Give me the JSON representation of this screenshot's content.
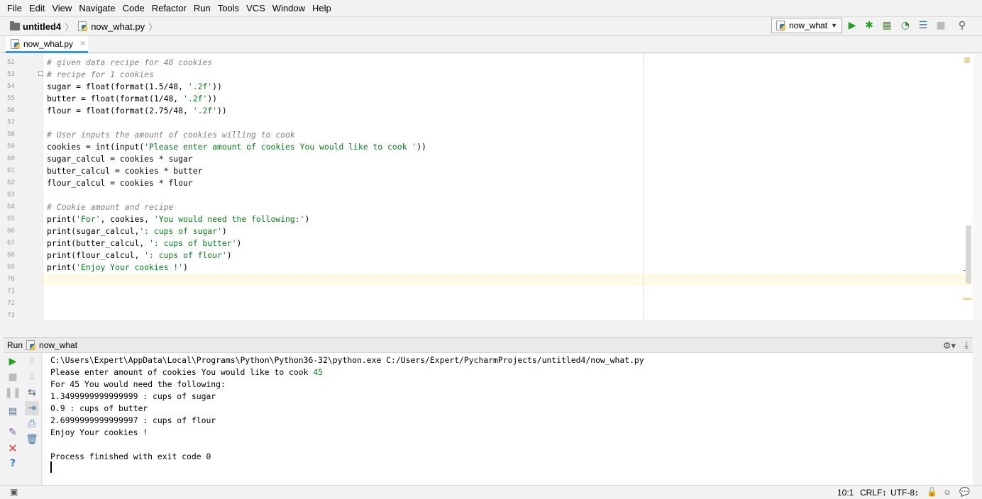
{
  "menu": [
    "File",
    "Edit",
    "View",
    "Navigate",
    "Code",
    "Refactor",
    "Run",
    "Tools",
    "VCS",
    "Window",
    "Help"
  ],
  "breadcrumb": {
    "project": "untitled4",
    "file": "now_what.py"
  },
  "run_config": {
    "label": "now_what"
  },
  "editor_tab": {
    "label": "now_what.py"
  },
  "code_lines": [
    {
      "num": "52",
      "text": "# given data recipe for 48 cookies",
      "kind": "comment"
    },
    {
      "num": "53",
      "text": "# recipe for 1 cookies",
      "kind": "comment"
    },
    {
      "num": "54",
      "text": "sugar = float(format(1.5/48, '.2f'))",
      "kind": "code"
    },
    {
      "num": "55",
      "text": "butter = float(format(1/48, '.2f'))",
      "kind": "code"
    },
    {
      "num": "56",
      "text": "flour = float(format(2.75/48, '.2f'))",
      "kind": "code"
    },
    {
      "num": "57",
      "text": "",
      "kind": "code"
    },
    {
      "num": "58",
      "text": "# User inputs the amount of cookies willing to cook",
      "kind": "comment"
    },
    {
      "num": "59",
      "text": "cookies = int(input('Please enter amount of cookies You would like to cook '))",
      "kind": "code"
    },
    {
      "num": "60",
      "text": "sugar_calcul = cookies * sugar",
      "kind": "code"
    },
    {
      "num": "61",
      "text": "butter_calcul = cookies * butter",
      "kind": "code"
    },
    {
      "num": "62",
      "text": "flour_calcul = cookies * flour",
      "kind": "code"
    },
    {
      "num": "63",
      "text": "",
      "kind": "code"
    },
    {
      "num": "64",
      "text": "# Cookie amount and recipe",
      "kind": "comment"
    },
    {
      "num": "65",
      "text": "print('For', cookies, 'You would need the following:')",
      "kind": "code"
    },
    {
      "num": "66",
      "text": "print(sugar_calcul,': cups of sugar')",
      "kind": "code"
    },
    {
      "num": "67",
      "text": "print(butter_calcul, ': cups of butter')",
      "kind": "code"
    },
    {
      "num": "68",
      "text": "print(flour_calcul, ': cups of flour')",
      "kind": "code"
    },
    {
      "num": "69",
      "text": "print('Enjoy Your cookies !')",
      "kind": "code"
    },
    {
      "num": "70",
      "text": "",
      "kind": "code"
    },
    {
      "num": "71",
      "text": "",
      "kind": "code"
    },
    {
      "num": "72",
      "text": "",
      "kind": "code"
    },
    {
      "num": "73",
      "text": "",
      "kind": "code"
    }
  ],
  "run_panel": {
    "label": "Run",
    "name": "now_what"
  },
  "console_lines": [
    {
      "text": "C:\\Users\\Expert\\AppData\\Local\\Programs\\Python\\Python36-32\\python.exe C:/Users/Expert/PycharmProjects/untitled4/now_what.py",
      "input": ""
    },
    {
      "text": "Please enter amount of cookies You would like to cook ",
      "input": "45"
    },
    {
      "text": "For 45 You would need the following:",
      "input": ""
    },
    {
      "text": "1.3499999999999999 : cups of sugar",
      "input": ""
    },
    {
      "text": "0.9 : cups of butter",
      "input": ""
    },
    {
      "text": "2.6999999999999997 : cups of flour",
      "input": ""
    },
    {
      "text": "Enjoy Your cookies !",
      "input": ""
    },
    {
      "text": "",
      "input": ""
    },
    {
      "text": "Process finished with exit code 0",
      "input": ""
    }
  ],
  "status": {
    "position": "10:1",
    "line_sep": "CRLF↕",
    "encoding": "UTF-8↕"
  },
  "colors": {
    "comment": "#808080",
    "string": "#067d17",
    "current_line": "#fffae3",
    "run_green": "#21a121",
    "stop_red": "#e0393d"
  }
}
